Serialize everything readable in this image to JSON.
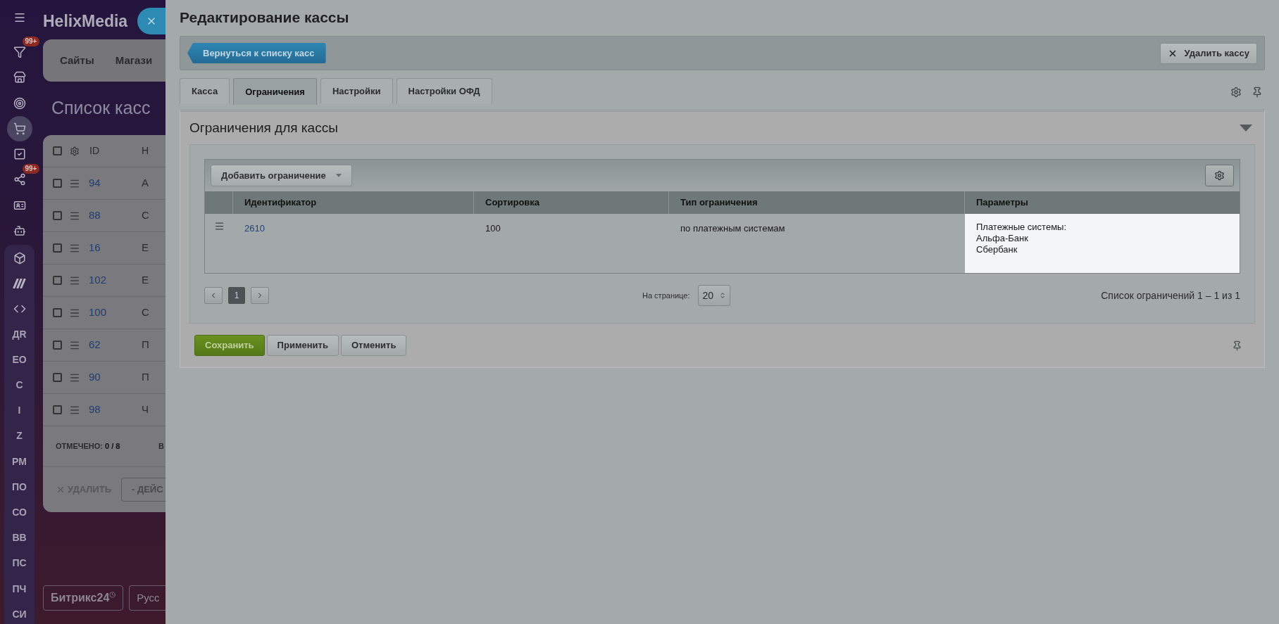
{
  "background_page": {
    "app_name": "HelixMedia",
    "sidebar_icons": [
      {
        "selected": false
      },
      {
        "badge": "99+",
        "selected": false
      },
      {
        "selected": false
      },
      {
        "selected": false
      },
      {
        "selected": true
      },
      {
        "selected": false
      },
      {
        "badge": "99+",
        "selected": false
      },
      {
        "selected": false
      },
      {
        "selected": false
      },
      {
        "selected": false
      },
      {
        "selected": false
      },
      {
        "selected": false
      }
    ],
    "sidebar_labels": [
      "ДR",
      "ЕО",
      "С",
      "I",
      "Z",
      "РМ",
      "ПО",
      "СО",
      "ВВ",
      "ПС",
      "ПЧ",
      "СИ"
    ],
    "top_tabs": [
      "Сайты",
      "Магази"
    ],
    "page_title": "Список касс",
    "list": {
      "header_checked": false,
      "columns": [
        "ID",
        "Н"
      ],
      "rows": [
        {
          "checked": false,
          "id": "94",
          "name": "А"
        },
        {
          "checked": false,
          "id": "88",
          "name": "С"
        },
        {
          "checked": false,
          "id": "16",
          "name": "Е"
        },
        {
          "checked": false,
          "id": "102",
          "name": "Е"
        },
        {
          "checked": false,
          "id": "100",
          "name": "С"
        },
        {
          "checked": false,
          "id": "62",
          "name": "П"
        },
        {
          "checked": false,
          "id": "90",
          "name": "П"
        },
        {
          "checked": false,
          "id": "98",
          "name": "Ч"
        }
      ],
      "marked_label": "ОТМЕЧЕНО:",
      "marked_value": "0 / 8",
      "footer_column_2": "В",
      "delete": "УДАЛИТЬ",
      "action": "- ДЕЙС"
    },
    "footer_buttons": [
      "Битрикс24",
      "Русс"
    ]
  },
  "panel": {
    "title": "Редактирование кассы",
    "back_button": "Вернуться к списку касс",
    "delete_button": "Удалить кассу",
    "tabs": [
      {
        "label": "Касса",
        "selected": false
      },
      {
        "label": "Ограничения",
        "selected": true
      },
      {
        "label": "Настройки",
        "selected": false
      },
      {
        "label": "Настройки ОФД",
        "selected": false
      }
    ],
    "section": {
      "title": "Ограничения для кассы",
      "add_button": "Добавить ограничение",
      "table": {
        "columns": [
          "Идентификатор",
          "Сортировка",
          "Тип ограничения",
          "Параметры"
        ],
        "rows": [
          {
            "id": "2610",
            "sort": "100",
            "type": "по платежным системам",
            "params": [
              "Платежные системы:",
              "Альфа-Банк",
              "Сбербанк"
            ]
          }
        ]
      },
      "pager": {
        "pages": [
          {
            "label": "1",
            "selected": true
          }
        ],
        "per_page_label": "На странице:",
        "per_page": "20",
        "summary": "Список ограничений 1 – 1 из 1"
      }
    },
    "buttons": [
      {
        "label": "Сохранить",
        "kind": "primary"
      },
      {
        "label": "Применить",
        "kind": "default"
      },
      {
        "label": "Отменить",
        "kind": "default"
      }
    ]
  }
}
